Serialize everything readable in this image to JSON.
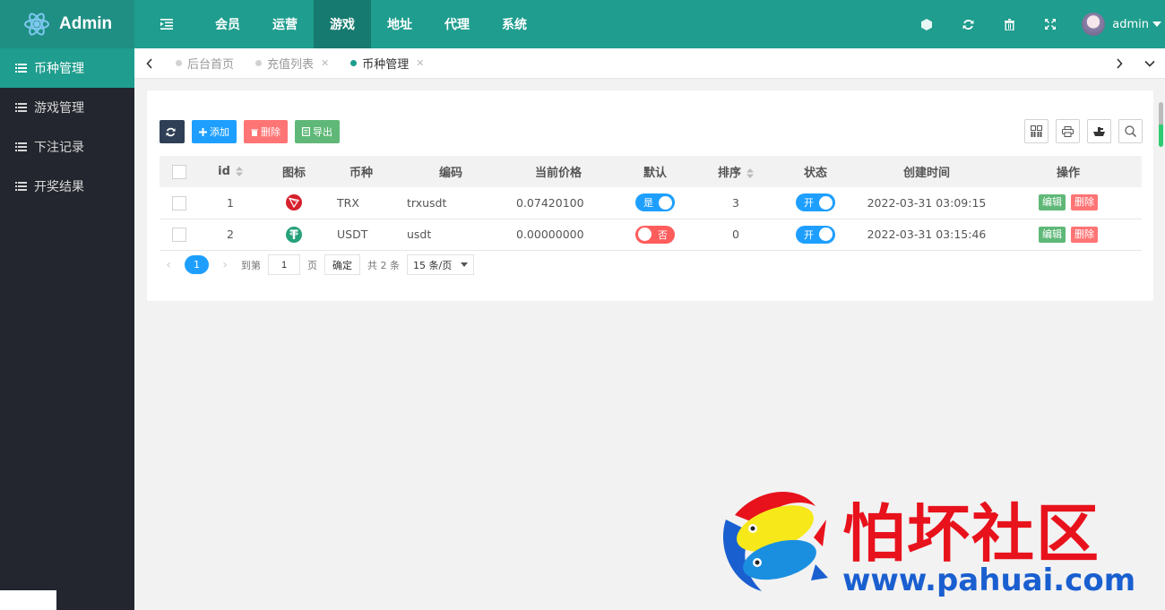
{
  "app": {
    "title": "Admin"
  },
  "sidebar": {
    "items": [
      {
        "label": "币种管理",
        "active": true
      },
      {
        "label": "游戏管理"
      },
      {
        "label": "下注记录"
      },
      {
        "label": "开奖结果"
      }
    ]
  },
  "topnav": {
    "items": [
      {
        "label": "会员"
      },
      {
        "label": "运营"
      },
      {
        "label": "游戏",
        "active": true
      },
      {
        "label": "地址"
      },
      {
        "label": "代理"
      },
      {
        "label": "系统"
      }
    ],
    "username": "admin",
    "icons": [
      "cube-icon",
      "refresh-icon",
      "trash-icon",
      "fullscreen-icon"
    ]
  },
  "tabs": [
    {
      "label": "后台首页"
    },
    {
      "label": "充值列表",
      "closable": true
    },
    {
      "label": "币种管理",
      "active": true,
      "closable": true
    }
  ],
  "toolbar": {
    "add": "添加",
    "delete": "删除",
    "export": "导出"
  },
  "table": {
    "headers": [
      "id",
      "图标",
      "币种",
      "编码",
      "当前价格",
      "默认",
      "排序",
      "状态",
      "创建时间",
      "操作"
    ],
    "rows": [
      {
        "id": "1",
        "coin": "TRX",
        "code": "trxusdt",
        "price": "0.07420100",
        "default": "是",
        "sort": "3",
        "status": "开",
        "created": "2022-03-31 03:09:15",
        "icon": "tron-icon",
        "icon_color": "#d6202d"
      },
      {
        "id": "2",
        "coin": "USDT",
        "code": "usdt",
        "price": "0.00000000",
        "default": "否",
        "sort": "0",
        "status": "开",
        "created": "2022-03-31 03:15:46",
        "icon": "tether-icon",
        "icon_color": "#26a17b"
      }
    ],
    "edit_label": "编辑",
    "delete_label": "删除"
  },
  "pager": {
    "current": "1",
    "goto_label": "到第",
    "page_value": "1",
    "page_unit": "页",
    "confirm": "确定",
    "total": "共 2 条",
    "page_size": "15 条/页"
  },
  "watermark": {
    "title": "怕坏社区",
    "url": "www.pahuai.com"
  },
  "colors": {
    "primary": "#1f9d8e",
    "sidebar": "#23262e",
    "blue": "#1e9fff",
    "red": "#ff5c5c",
    "green": "#5fb878"
  }
}
